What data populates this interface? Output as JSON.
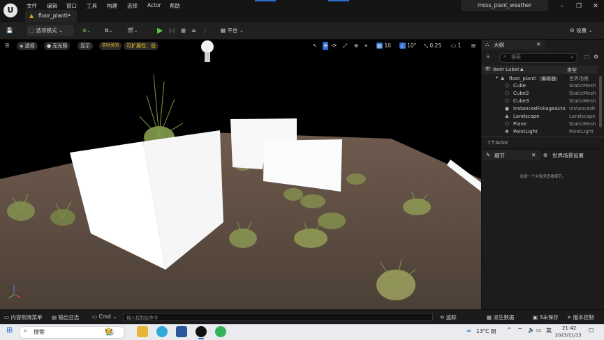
{
  "titlebar": {
    "menu": [
      "文件",
      "编辑",
      "窗口",
      "工具",
      "构建",
      "选择",
      "Actor",
      "帮助"
    ],
    "document_tab": "floor_plantl•",
    "project_name": "moss_plant_weather"
  },
  "toolbar": {
    "select_mode": "选项模式",
    "platform": "平台",
    "settings": "设置"
  },
  "viewport": {
    "perspective": "透视",
    "lit": "无光照",
    "show": "显示",
    "realtime": "实时关闭",
    "scalability": "可扩展性：低",
    "grid_snap": "10",
    "rot_snap": "10°",
    "scale_snap": "0.25",
    "camera_speed": "1"
  },
  "outliner": {
    "title": "大纲",
    "search_placeholder": "搜索",
    "col_label": "Item Label",
    "col_type": "类型",
    "rows": [
      {
        "label": "floor_plantl（编辑器）",
        "type": "世界场景"
      },
      {
        "label": "Cube",
        "type": "StaticMesh"
      },
      {
        "label": "Cube2",
        "type": "StaticMesh"
      },
      {
        "label": "Cube3",
        "type": "StaticMesh"
      },
      {
        "label": "InstancedFoliageActo",
        "type": "InstancedF"
      },
      {
        "label": "Landscape",
        "type": "Landscape"
      },
      {
        "label": "Plane",
        "type": "StaticMesh"
      },
      {
        "label": "PointLight",
        "type": "PointLight"
      }
    ],
    "actor_count": "7个Actor"
  },
  "details": {
    "title": "细节",
    "world_settings": "世界场景设置",
    "empty_text": "选择一个对象来查看细节。"
  },
  "statusbar": {
    "content_drawer": "内容侧滑菜单",
    "output_log": "输出日志",
    "cmd": "Cmd",
    "cmd_placeholder": "输入控制台命令",
    "trace": "追踪",
    "derived_data": "派生数据",
    "unsaved": "3未保存",
    "revision_control": "版本控制"
  },
  "taskbar": {
    "search": "搜索",
    "weather": "13°C 阴",
    "ime": "英",
    "time": "21:42",
    "date": "2023/11/13"
  }
}
